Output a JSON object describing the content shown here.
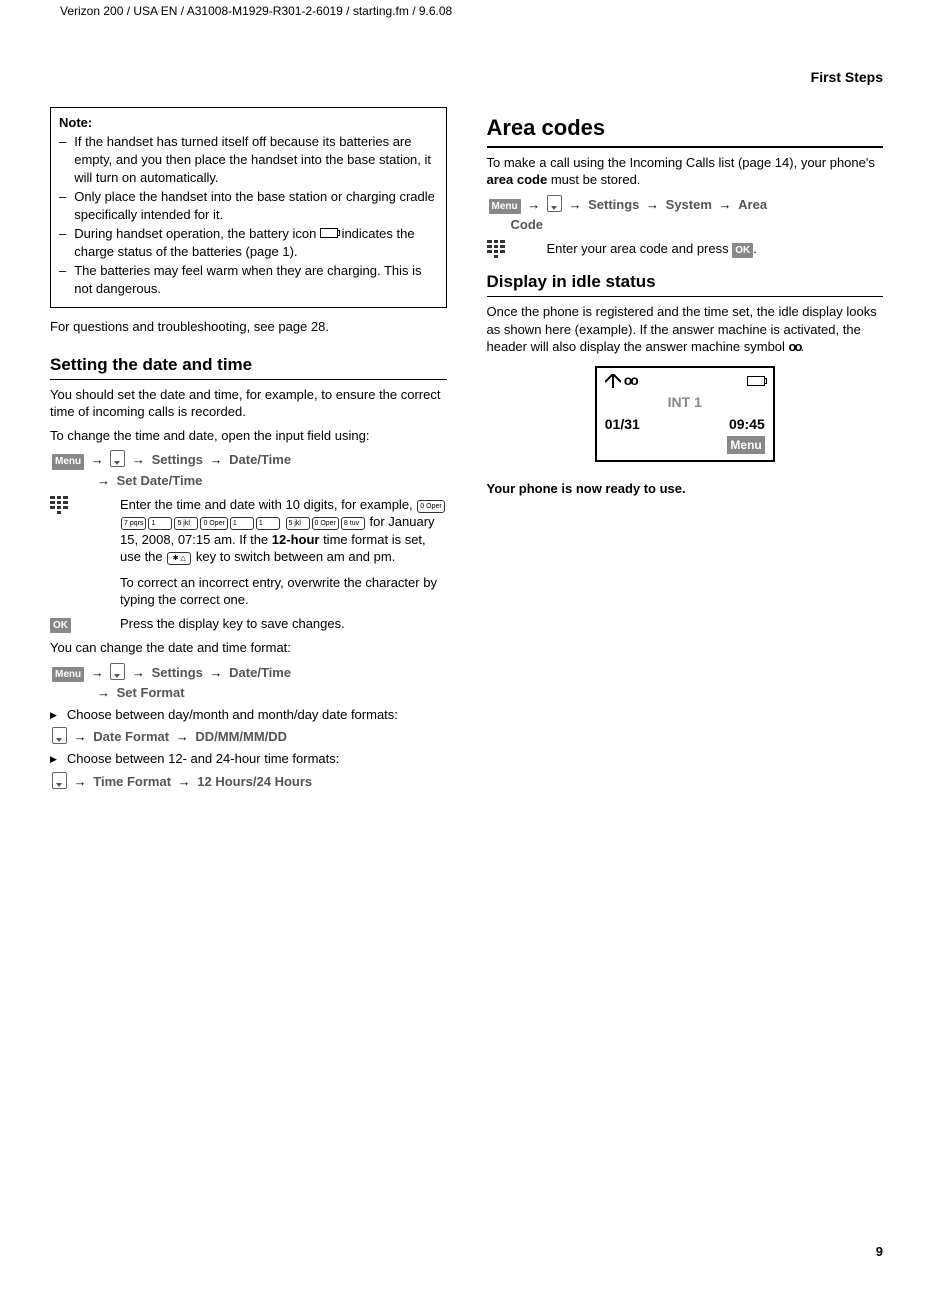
{
  "header": {
    "doc_path": "Verizon 200 / USA EN / A31008-M1929-R301-2-6019 / starting.fm / 9.6.08",
    "section_label": "First Steps"
  },
  "note": {
    "title": "Note:",
    "items": [
      "If the handset has turned itself off because its batteries are empty, and you then place the handset into the base station, it will turn on automatically.",
      "Only place the handset into the base station or charging cradle specifically intended for it.",
      "During handset operation, the battery icon  indicates the charge status of the batteries (page 1).",
      "The batteries may feel warm when they are charging. This is not dangerous."
    ]
  },
  "leftcol": {
    "troubleshoot": "For questions and troubleshooting, see page 28.",
    "h_datetime": "Setting the date and time",
    "dt_intro": "You should set the date and time, for example, to ensure the correct time of incoming calls is recorded.",
    "dt_change": "To change the time and date, open the input field using:",
    "menu_label": "Menu",
    "settings_label": "Settings",
    "date_time_label": "Date/Time",
    "set_date_time_label": "Set Date/Time",
    "enter_time_a": "Enter the time and date with 10 digits, for example, ",
    "enter_time_b": " for January 15, 2008, 07:15 am. If the ",
    "enter_time_bold": "12-hour",
    "enter_time_c": " time format is set, use the ",
    "enter_time_d": " key to switch between am and pm.",
    "keys_example": [
      "0 Oper",
      "7 pqrs",
      "1",
      "5 jkl",
      "0 Oper",
      "1",
      "1",
      "5 jkl",
      "0 Oper",
      "8 tuv"
    ],
    "star_key_label": "✱ △",
    "correct_entry": "To correct an incorrect entry, overwrite the character by typing the correct one.",
    "ok_label": "OK",
    "press_ok": "Press the display key to save changes.",
    "change_format": "You can change the date and time format:",
    "set_format_label": "Set Format",
    "choose_date": "Choose between day/month and month/day date formats:",
    "date_format_label": "Date Format",
    "date_format_vals": "DD/MM/MM/DD",
    "choose_time": "Choose between 12- and 24-hour time formats:",
    "time_format_label": "Time Format",
    "time_format_vals": "12 Hours/24 Hours"
  },
  "rightcol": {
    "h_area": "Area codes",
    "area_intro_a": "To make a call using the Incoming Calls list (page 14), your phone's ",
    "area_intro_bold": "area code",
    "area_intro_b": " must be stored.",
    "system_label": "System",
    "area_code_label": "Area Code",
    "enter_area": "Enter your area code and press ",
    "enter_area_end": ".",
    "h_idle": "Display in idle status",
    "idle_intro_a": "Once the phone is registered and the time set, the idle display looks as shown here (example). If the answer machine is activated, the header will also display the answer machine symbol ",
    "idle_intro_b": ".",
    "display": {
      "int": "INT 1",
      "date": "01/31",
      "time": "09:45",
      "menu": "Menu"
    },
    "ready": "Your phone is now ready to use."
  },
  "page_number": "9"
}
